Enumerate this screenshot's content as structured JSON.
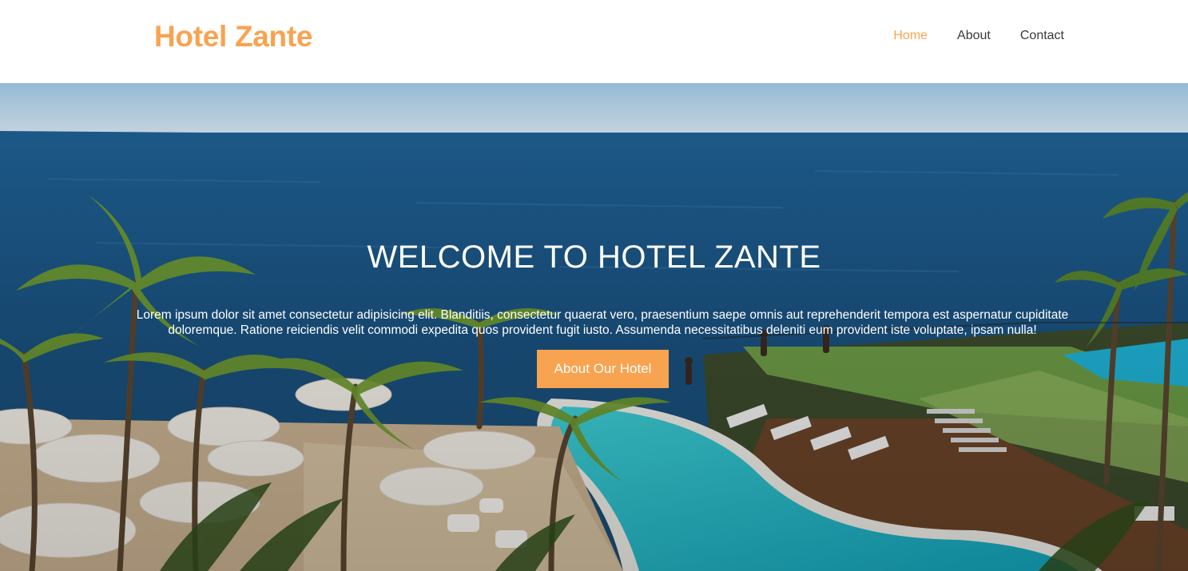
{
  "header": {
    "brand": "Hotel Zante",
    "nav": [
      {
        "label": "Home",
        "active": true
      },
      {
        "label": "About",
        "active": false
      },
      {
        "label": "Contact",
        "active": false
      }
    ]
  },
  "hero": {
    "title": "WELCOME TO HOTEL ZANTE",
    "text": "Lorem ipsum dolor sit amet consectetur adipisicing elit. Blanditiis, consectetur quaerat vero, praesentium saepe omnis aut reprehenderit tempora est aspernatur cupiditate doloremque. Ratione reiciendis velit commodi expedita quos provident fugit iusto. Assumenda necessitatibus deleniti eum provident iste voluptate, ipsam nulla!",
    "button_label": "About Our Hotel",
    "background_image": "resort-pool-ocean-palms"
  },
  "colors": {
    "accent": "#f8a350",
    "nav_text": "#3a3a3a",
    "hero_text": "#ffffff"
  }
}
